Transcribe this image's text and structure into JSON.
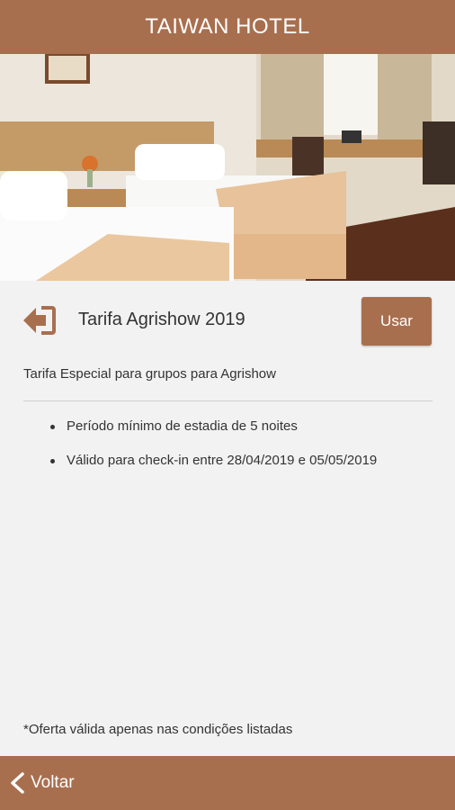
{
  "header": {
    "title": "TAIWAN HOTEL"
  },
  "hero": {
    "image": "hotel-room-photo"
  },
  "rate": {
    "icon": "exit-arrow-icon",
    "title": "Tarifa Agrishow 2019",
    "use_label": "Usar",
    "description": "Tarifa Especial para grupos para Agrishow",
    "conditions": [
      "Período mínimo de estadia de 5 noites",
      "Válido para check-in entre 28/04/2019 e 05/05/2019"
    ]
  },
  "footnote": "*Oferta válida apenas nas condições listadas",
  "footer": {
    "back_label": "Voltar",
    "back_icon": "chevron-left-icon"
  },
  "colors": {
    "brand": "#a86f4f",
    "background": "#f2f2f2",
    "text": "#333333"
  }
}
